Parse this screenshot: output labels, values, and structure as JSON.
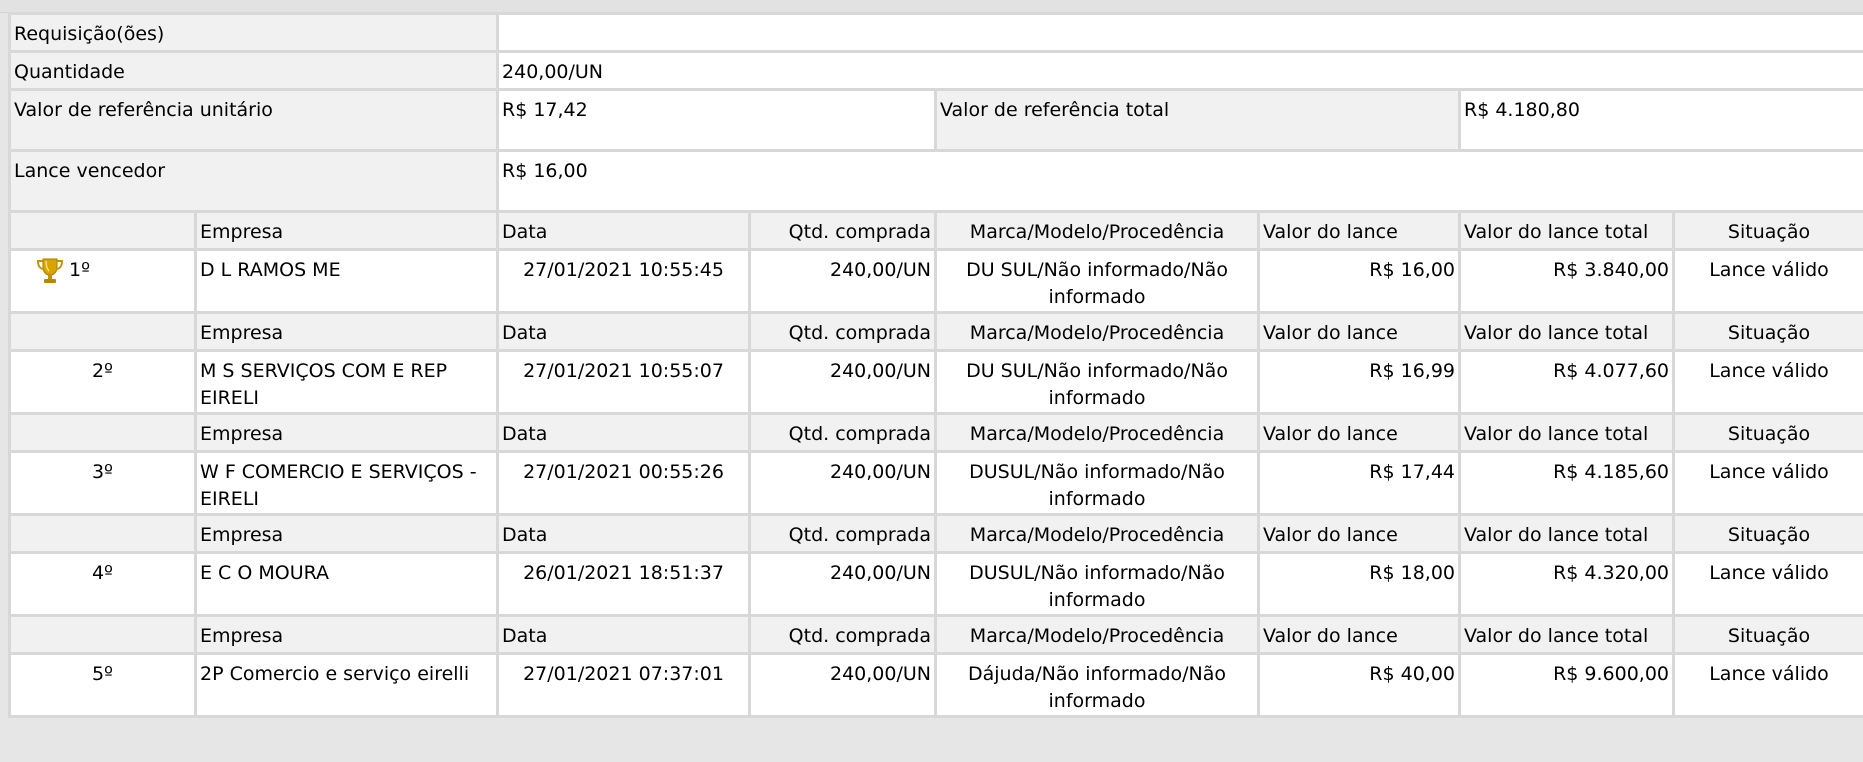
{
  "info": {
    "requisicao_label": "Requisição(ões)",
    "requisicao_value": "",
    "quantidade_label": "Quantidade",
    "quantidade_value": "240,00/UN",
    "valor_ref_unit_label": "Valor de referência unitário",
    "valor_ref_unit_value": "R$ 17,42",
    "valor_ref_total_label": "Valor de referência total",
    "valor_ref_total_value": "R$ 4.180,80",
    "lance_vencedor_label": "Lance vencedor",
    "lance_vencedor_value": "R$ 16,00"
  },
  "headers": {
    "empresa": "Empresa",
    "data": "Data",
    "qtd": "Qtd. comprada",
    "marca": "Marca/Modelo/Procedência",
    "valor": "Valor do lance",
    "valor_total": "Valor do lance total",
    "situacao": "Situação"
  },
  "bids": [
    {
      "rank": "1º",
      "empresa": "D L RAMOS ME",
      "data": "27/01/2021 10:55:45",
      "qtd": "240,00/UN",
      "marca": "DU SUL/Não informado/Não informado",
      "valor": "R$ 16,00",
      "valor_total": "R$ 3.840,00",
      "situacao": "Lance válido",
      "winner_icon": "trophy-icon"
    },
    {
      "rank": "2º",
      "empresa": "M S SERVIÇOS COM E REP EIRELI",
      "data": "27/01/2021 10:55:07",
      "qtd": "240,00/UN",
      "marca": "DU SUL/Não informado/Não informado",
      "valor": "R$ 16,99",
      "valor_total": "R$ 4.077,60",
      "situacao": "Lance válido"
    },
    {
      "rank": "3º",
      "empresa": "W F COMERCIO E SERVIÇOS - EIRELI",
      "data": "27/01/2021 00:55:26",
      "qtd": "240,00/UN",
      "marca": "DUSUL/Não informado/Não informado",
      "valor": "R$ 17,44",
      "valor_total": "R$ 4.185,60",
      "situacao": "Lance válido"
    },
    {
      "rank": "4º",
      "empresa": "E C O MOURA",
      "data": "26/01/2021 18:51:37",
      "qtd": "240,00/UN",
      "marca": "DUSUL/Não informado/Não informado",
      "valor": "R$ 18,00",
      "valor_total": "R$ 4.320,00",
      "situacao": "Lance válido"
    },
    {
      "rank": "5º",
      "empresa": "2P Comercio e serviço eirelli",
      "data": "27/01/2021 07:37:01",
      "qtd": "240,00/UN",
      "marca": "Dájuda/Não informado/Não informado",
      "valor": "R$ 40,00",
      "valor_total": "R$ 9.600,00",
      "situacao": "Lance válido"
    }
  ]
}
